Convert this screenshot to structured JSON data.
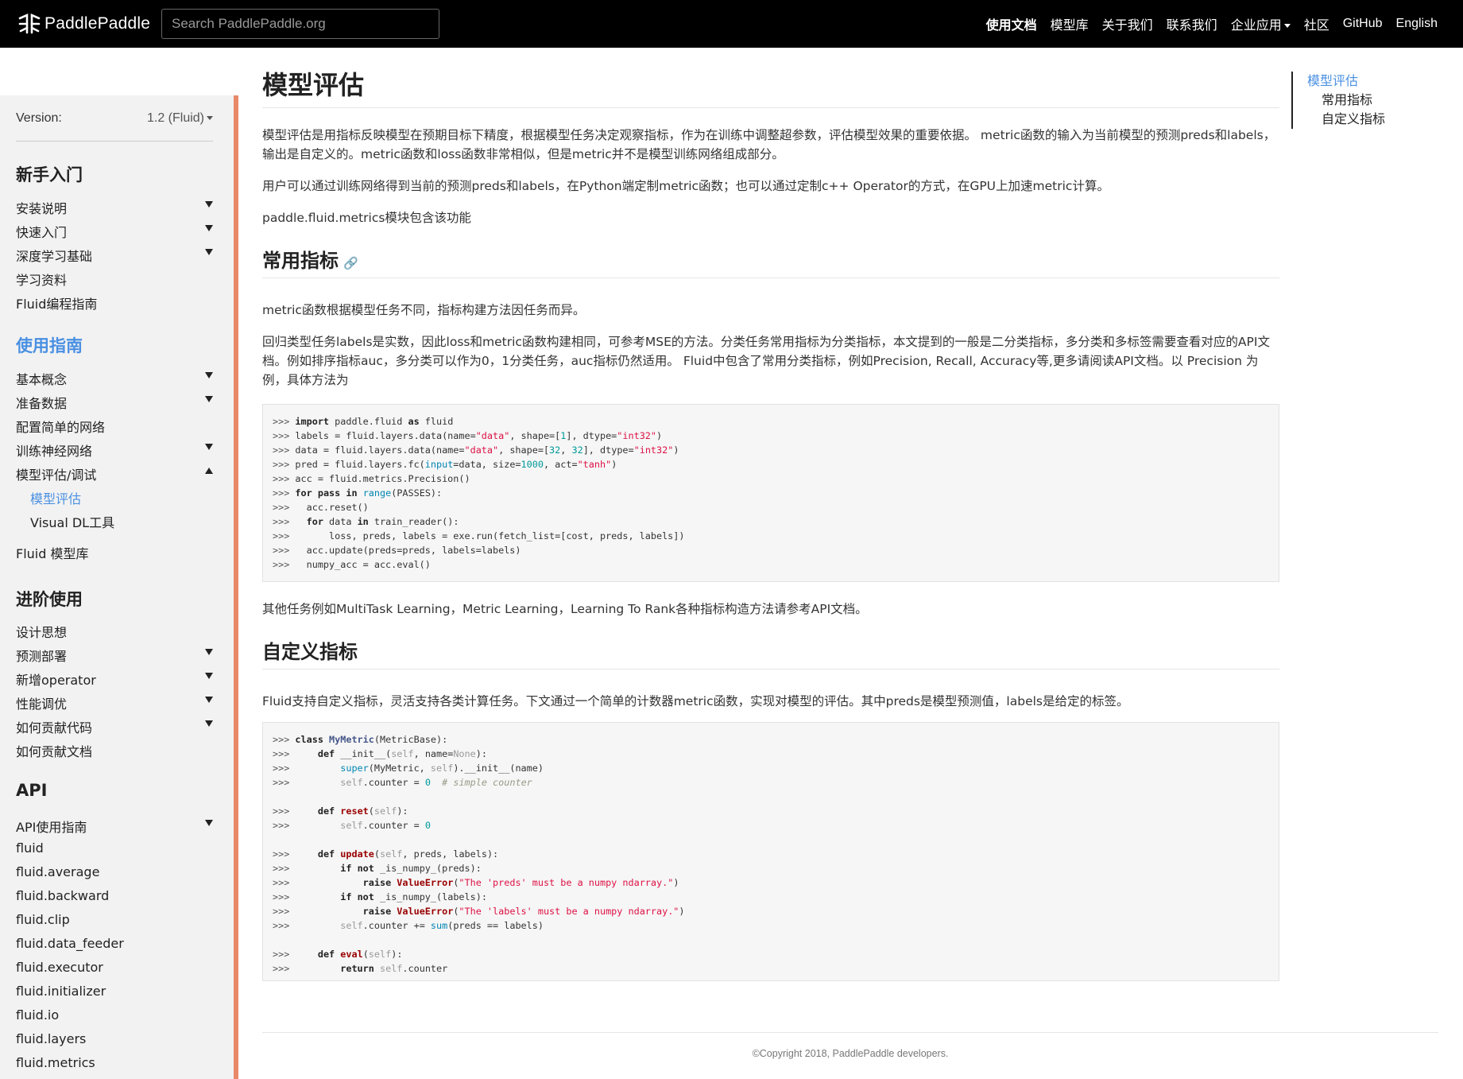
{
  "header": {
    "logo_text": "PaddlePaddle",
    "search_placeholder": "Search PaddlePaddle.org",
    "nav": [
      {
        "label": "使用文档",
        "active": true
      },
      {
        "label": "模型库"
      },
      {
        "label": "关于我们"
      },
      {
        "label": "联系我们"
      },
      {
        "label": "企业应用",
        "dropdown": true
      },
      {
        "label": "社区"
      },
      {
        "label": "GitHub"
      },
      {
        "label": "English"
      }
    ]
  },
  "sidebar": {
    "version_label": "Version:",
    "version_value": "1.2 (Fluid)",
    "sections": [
      {
        "title": "新手入门",
        "items": [
          {
            "label": "安装说明",
            "expand": "down"
          },
          {
            "label": "快速入门",
            "expand": "down"
          },
          {
            "label": "深度学习基础",
            "expand": "down"
          },
          {
            "label": "学习资料"
          },
          {
            "label": "Fluid编程指南"
          }
        ]
      },
      {
        "title": "使用指南",
        "items": [
          {
            "label": "基本概念",
            "expand": "down"
          },
          {
            "label": "准备数据",
            "expand": "down"
          },
          {
            "label": "配置简单的网络"
          },
          {
            "label": "训练神经网络",
            "expand": "down"
          },
          {
            "label": "模型评估/调试",
            "expand": "up"
          },
          {
            "label": "模型评估",
            "sub": true,
            "active": true
          },
          {
            "label": "Visual DL工具",
            "sub": true
          },
          {
            "label": "Fluid 模型库"
          }
        ]
      },
      {
        "title": "进阶使用",
        "items": [
          {
            "label": "设计思想"
          },
          {
            "label": "预测部署",
            "expand": "down"
          },
          {
            "label": "新增operator",
            "expand": "down"
          },
          {
            "label": "性能调优",
            "expand": "down"
          },
          {
            "label": "如何贡献代码",
            "expand": "down"
          },
          {
            "label": "如何贡献文档"
          }
        ]
      },
      {
        "title": "API",
        "items": [
          {
            "label": "API使用指南",
            "expand": "down"
          },
          {
            "label": "fluid"
          },
          {
            "label": "fluid.average"
          },
          {
            "label": "fluid.backward"
          },
          {
            "label": "fluid.clip"
          },
          {
            "label": "fluid.data_feeder"
          },
          {
            "label": "fluid.executor"
          },
          {
            "label": "fluid.initializer"
          },
          {
            "label": "fluid.io"
          },
          {
            "label": "fluid.layers"
          },
          {
            "label": "fluid.metrics"
          }
        ]
      }
    ]
  },
  "main": {
    "title": "模型评估",
    "intro": [
      "模型评估是用指标反映模型在预期目标下精度，根据模型任务决定观察指标，作为在训练中调整超参数，评估模型效果的重要依据。 metric函数的输入为当前模型的预测preds和labels，输出是自定义的。metric函数和loss函数非常相似，但是metric并不是模型训练网络组成部分。",
      "用户可以通过训练网络得到当前的预测preds和labels，在Python端定制metric函数；也可以通过定制c++ Operator的方式，在GPU上加速metric计算。",
      "paddle.fluid.metrics模块包含该功能"
    ],
    "section1": {
      "title": "常用指标",
      "paras": [
        "metric函数根据模型任务不同，指标构建方法因任务而异。",
        "回归类型任务labels是实数，因此loss和metric函数构建相同，可参考MSE的方法。分类任务常用指标为分类指标，本文提到的一般是二分类指标，多分类和多标签需要查看对应的API文档。例如排序指标auc，多分类可以作为0，1分类任务，auc指标仍然适用。 Fluid中包含了常用分类指标，例如Precision, Recall, Accuracy等,更多请阅读API文档。以 Precision 为例，具体方法为"
      ],
      "after_code": "其他任务例如MultiTask Learning，Metric Learning，Learning To Rank各种指标构造方法请参考API文档。"
    },
    "section2": {
      "title": "自定义指标",
      "para": "Fluid支持自定义指标，灵活支持各类计算任务。下文通过一个简单的计数器metric函数，实现对模型的评估。其中preds是模型预测值，labels是给定的标签。"
    }
  },
  "toc": {
    "items": [
      {
        "label": "模型评估",
        "active": true
      },
      {
        "label": "常用指标",
        "sub": true
      },
      {
        "label": "自定义指标",
        "sub": true
      }
    ]
  },
  "footer": {
    "text": "©Copyright 2018, PaddlePaddle developers."
  },
  "icons": {
    "logo": "paddlepaddle-logo-icon",
    "heading_link": "link-icon"
  },
  "colors": {
    "navbar_bg": "#000000",
    "accent_blue": "#4a90e2",
    "sidebar_bg": "#f2f2f2",
    "sidebar_border": "#e8896a"
  }
}
